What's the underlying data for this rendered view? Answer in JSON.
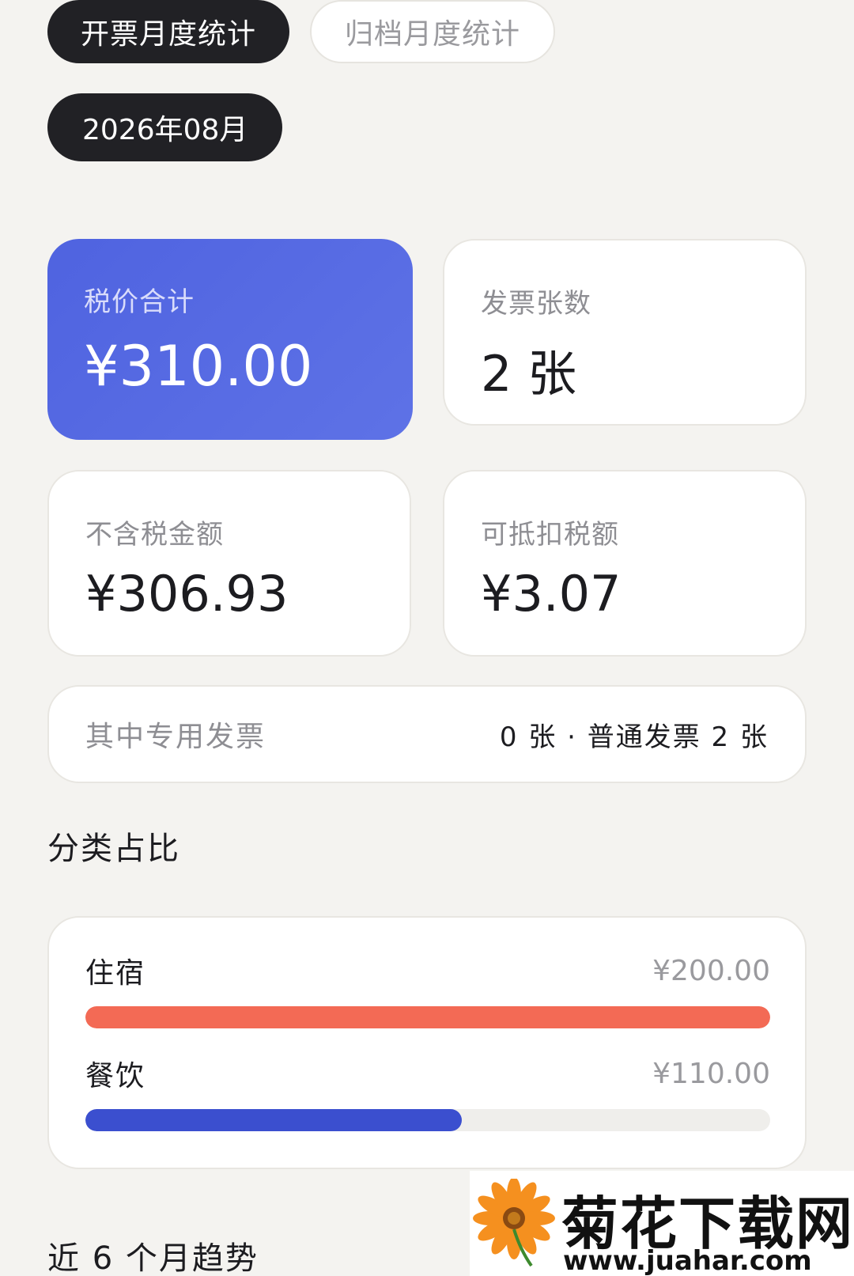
{
  "tabs": [
    {
      "label": "开票月度统计",
      "active": true
    },
    {
      "label": "归档月度统计",
      "active": false
    }
  ],
  "month_selector": {
    "label": "2026年08月"
  },
  "stats": {
    "total": {
      "label": "税价合计",
      "value": "¥310.00"
    },
    "count": {
      "label": "发票张数",
      "value": "2 张"
    },
    "pretax": {
      "label": "不含税金额",
      "value": "¥306.93"
    },
    "deductible": {
      "label": "可抵扣税额",
      "value": "¥3.07"
    }
  },
  "special": {
    "label": "其中专用发票",
    "value": "0 张 · 普通发票 2 张"
  },
  "category_section": {
    "title": "分类占比",
    "items": [
      {
        "name": "住宿",
        "amount": "¥200.00",
        "value": 200,
        "share": 1.0,
        "color": "#f36a55"
      },
      {
        "name": "餐饮",
        "amount": "¥110.00",
        "value": 110,
        "share": 0.55,
        "color": "#3b4fcf"
      }
    ]
  },
  "trend_section": {
    "title": "近 6 个月趋势"
  },
  "watermark": {
    "title": "菊花下载网",
    "url": "www.juahar.com"
  },
  "colors": {
    "accent": "#4f63e0",
    "dark_pill": "#212125",
    "lodging": "#f36a55",
    "dining": "#3b4fcf"
  }
}
